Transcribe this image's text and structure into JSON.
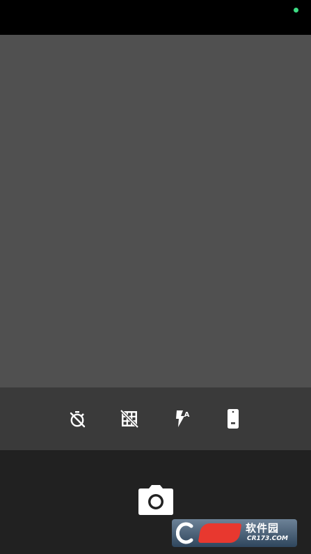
{
  "colors": {
    "status_bar": "#000000",
    "status_dot": "#3ddc84",
    "viewfinder": "#505050",
    "controls_bar": "#3a3a3a",
    "bottom_bar": "#212121",
    "icon": "#ffffff"
  },
  "controls": [
    {
      "icon": "timer-off-icon"
    },
    {
      "icon": "grid-off-icon"
    },
    {
      "icon": "flash-auto-icon",
      "badge": "A"
    },
    {
      "icon": "camera-switch-icon"
    }
  ],
  "shutter": {
    "icon": "camera-icon"
  },
  "watermark": {
    "brand": "软件园",
    "domain": "CR173.COM"
  }
}
